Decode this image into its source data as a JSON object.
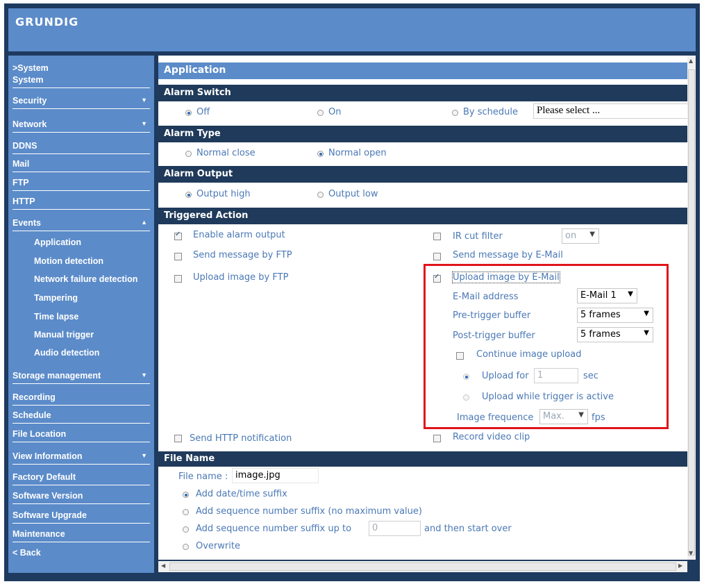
{
  "header": {
    "logo": "GRUNDIG"
  },
  "sidebar": {
    "items": [
      {
        "label": ">System",
        "arrow": ""
      },
      {
        "label": "System",
        "arrow": ""
      },
      {
        "label": "Security",
        "arrow": "▼"
      },
      {
        "label": "Network",
        "arrow": "▼"
      },
      {
        "label": "DDNS",
        "arrow": ""
      },
      {
        "label": "Mail",
        "arrow": ""
      },
      {
        "label": "FTP",
        "arrow": ""
      },
      {
        "label": "HTTP",
        "arrow": ""
      },
      {
        "label": "Events",
        "arrow": "▲"
      },
      {
        "label": "Application",
        "arrow": ""
      },
      {
        "label": "Motion detection",
        "arrow": ""
      },
      {
        "label": "Network failure detection",
        "arrow": ""
      },
      {
        "label": "Tampering",
        "arrow": ""
      },
      {
        "label": "Time lapse",
        "arrow": ""
      },
      {
        "label": "Manual trigger",
        "arrow": ""
      },
      {
        "label": "Audio detection",
        "arrow": ""
      },
      {
        "label": "Storage management",
        "arrow": "▼"
      },
      {
        "label": "Recording",
        "arrow": ""
      },
      {
        "label": "Schedule",
        "arrow": ""
      },
      {
        "label": "File Location",
        "arrow": ""
      },
      {
        "label": "View Information",
        "arrow": "▼"
      },
      {
        "label": "Factory Default",
        "arrow": ""
      },
      {
        "label": "Software Version",
        "arrow": ""
      },
      {
        "label": "Software Upgrade",
        "arrow": ""
      },
      {
        "label": "Maintenance",
        "arrow": ""
      },
      {
        "label": "< Back",
        "arrow": ""
      }
    ]
  },
  "main": {
    "title": "Application",
    "alarm_switch": {
      "heading": "Alarm Switch",
      "off": "Off",
      "on": "On",
      "by_schedule": "By schedule",
      "schedule_select": "Please select ..."
    },
    "alarm_type": {
      "heading": "Alarm Type",
      "normal_close": "Normal close",
      "normal_open": "Normal open"
    },
    "alarm_output": {
      "heading": "Alarm Output",
      "output_high": "Output high",
      "output_low": "Output low"
    },
    "triggered_action": {
      "heading": "Triggered Action",
      "enable_alarm_output": "Enable alarm output",
      "ir_cut_filter": "IR cut filter",
      "ir_cut_value": "on",
      "send_message_ftp": "Send message by FTP",
      "send_message_email": "Send message by E-Mail",
      "upload_image_ftp": "Upload image by FTP",
      "upload_image_email": "Upload image by E-Mail",
      "email_address_label": "E-Mail address",
      "email_address_value": "E-Mail 1",
      "pre_trigger_label": "Pre-trigger buffer",
      "pre_trigger_value": "5 frames",
      "post_trigger_label": "Post-trigger buffer",
      "post_trigger_value": "5 frames",
      "continue_upload": "Continue image upload",
      "upload_for": "Upload for",
      "upload_for_value": "1",
      "upload_for_unit": "sec",
      "upload_while_active": "Upload while trigger is active",
      "image_frequence_label": "Image frequence",
      "image_frequence_value": "Max.",
      "image_frequence_unit": "fps",
      "send_http": "Send HTTP notification",
      "record_video": "Record video clip"
    },
    "file_name": {
      "heading": "File Name",
      "label": "File name :",
      "value": "image.jpg",
      "add_datetime": "Add date/time suffix",
      "add_seq_nomax": "Add sequence number suffix (no maximum value)",
      "add_seq_upto": "Add sequence number suffix up to",
      "seq_upto_value": "0",
      "then_start_over": "and then start over",
      "overwrite": "Overwrite"
    }
  },
  "colors": {
    "header_blue": "#5b8bc9",
    "bar_dark": "#1f3a5a",
    "highlight_red": "#e0151b",
    "text_blue": "#4a78b5"
  }
}
